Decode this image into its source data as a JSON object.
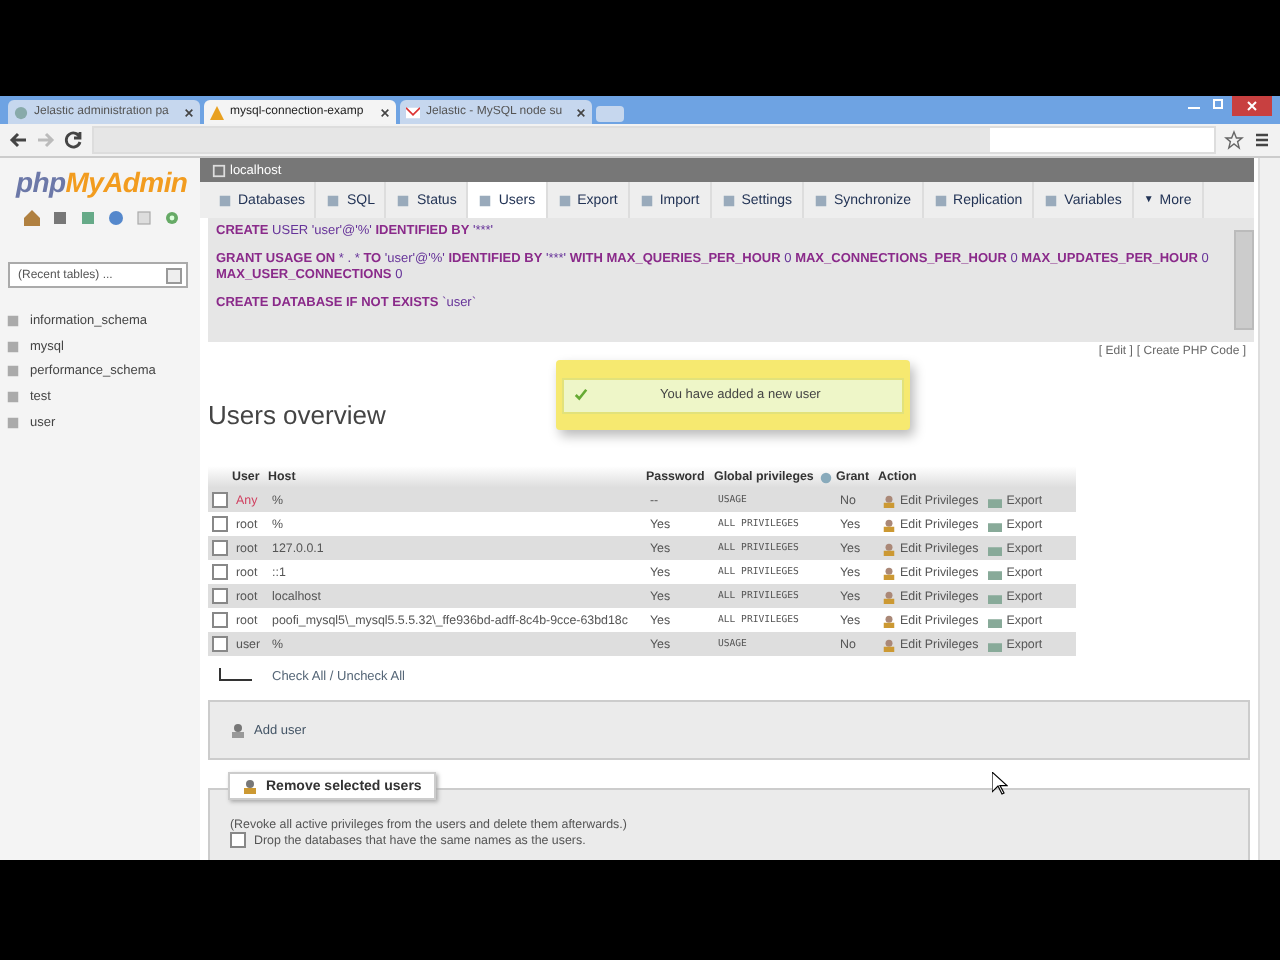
{
  "browser": {
    "tabs": [
      {
        "title": "Jelastic administration pa",
        "selected": false,
        "kind": "globe"
      },
      {
        "title": "mysql-connection-examp",
        "selected": true,
        "kind": "pma"
      },
      {
        "title": "Jelastic - MySQL node su",
        "selected": false,
        "kind": "mail"
      }
    ]
  },
  "sidebar": {
    "logo_prefix": "php",
    "logo_suffix": "MyAdmin",
    "recent_select": "(Recent tables) ...",
    "databases": [
      "information_schema",
      "mysql",
      "performance_schema",
      "test",
      "user"
    ]
  },
  "breadcrumb": "localhost",
  "nav_tabs": [
    {
      "label": "Databases",
      "selected": false
    },
    {
      "label": "SQL",
      "selected": false
    },
    {
      "label": "Status",
      "selected": false
    },
    {
      "label": "Users",
      "selected": true
    },
    {
      "label": "Export",
      "selected": false
    },
    {
      "label": "Import",
      "selected": false
    },
    {
      "label": "Settings",
      "selected": false
    },
    {
      "label": "Synchronize",
      "selected": false
    },
    {
      "label": "Replication",
      "selected": false
    },
    {
      "label": "Variables",
      "selected": false
    },
    {
      "label": "More",
      "selected": false,
      "caret": "▼"
    }
  ],
  "sql_statements": [
    [
      {
        "text": "CREATE",
        "keyword": true
      },
      {
        "text": " USER 'user'@'%' ",
        "keyword": false
      },
      {
        "text": "IDENTIFIED BY",
        "keyword": true
      },
      {
        "text": " '***'",
        "keyword": false
      }
    ],
    [
      {
        "text": "GRANT USAGE ON",
        "keyword": true
      },
      {
        "text": " * . * ",
        "keyword": false
      },
      {
        "text": "TO",
        "keyword": true
      },
      {
        "text": " 'user'@'%' ",
        "keyword": false
      },
      {
        "text": "IDENTIFIED BY",
        "keyword": true
      },
      {
        "text": " '***' ",
        "keyword": false
      },
      {
        "text": "WITH MAX_QUERIES_PER_HOUR",
        "keyword": true
      },
      {
        "text": " 0 ",
        "keyword": false
      },
      {
        "text": "MAX_CONNECTIONS_PER_HOUR",
        "keyword": true
      },
      {
        "text": " 0 ",
        "keyword": false
      },
      {
        "text": "MAX_UPDATES_PER_HOUR",
        "keyword": true
      },
      {
        "text": " 0 ",
        "keyword": false
      },
      {
        "text": "MAX_USER_CONNECTIONS",
        "keyword": true
      },
      {
        "text": " 0",
        "keyword": false
      }
    ],
    [
      {
        "text": "CREATE DATABASE IF NOT EXISTS",
        "keyword": true
      },
      {
        "text": " `user`",
        "keyword": false
      }
    ]
  ],
  "sql_links": [
    "[ Edit ]",
    "[ Create PHP Code ]"
  ],
  "notification": "You have added a new user",
  "heading": "Users overview",
  "table": {
    "columns": [
      "User",
      "Host",
      "Password",
      "Global privileges",
      "Grant",
      "Action"
    ],
    "rows": [
      {
        "user": "Any",
        "anonymous": true,
        "host": "%",
        "password": "--",
        "privileges": "USAGE",
        "grant": "No",
        "checked": false,
        "edit_label": "Edit Privileges",
        "export_label": "Export"
      },
      {
        "user": "root",
        "anonymous": false,
        "host": "%",
        "password": "Yes",
        "privileges": "ALL PRIVILEGES",
        "grant": "Yes",
        "checked": false,
        "edit_label": "Edit Privileges",
        "export_label": "Export"
      },
      {
        "user": "root",
        "anonymous": false,
        "host": "127.0.0.1",
        "password": "Yes",
        "privileges": "ALL PRIVILEGES",
        "grant": "Yes",
        "checked": false,
        "edit_label": "Edit Privileges",
        "export_label": "Export"
      },
      {
        "user": "root",
        "anonymous": false,
        "host": "::1",
        "password": "Yes",
        "privileges": "ALL PRIVILEGES",
        "grant": "Yes",
        "checked": false,
        "edit_label": "Edit Privileges",
        "export_label": "Export"
      },
      {
        "user": "root",
        "anonymous": false,
        "host": "localhost",
        "password": "Yes",
        "privileges": "ALL PRIVILEGES",
        "grant": "Yes",
        "checked": false,
        "edit_label": "Edit Privileges",
        "export_label": "Export"
      },
      {
        "user": "root",
        "anonymous": false,
        "host": "poofi_mysql5\\_mysql5.5.5.32\\_ffe936bd-adff-8c4b-9cce-63bd18c",
        "password": "Yes",
        "privileges": "ALL PRIVILEGES",
        "grant": "Yes",
        "checked": false,
        "edit_label": "Edit Privileges",
        "export_label": "Export"
      },
      {
        "user": "user",
        "anonymous": false,
        "host": "%",
        "password": "Yes",
        "privileges": "USAGE",
        "grant": "No",
        "checked": false,
        "edit_label": "Edit Privileges",
        "export_label": "Export"
      }
    ]
  },
  "check_all": "Check All / Uncheck All",
  "add_user": "Add user",
  "remove": {
    "legend": "Remove selected users",
    "note": "(Revoke all active privileges from the users and delete them afterwards.)",
    "drop_label": "Drop the databases that have the same names as the users.",
    "drop_checked": false
  }
}
